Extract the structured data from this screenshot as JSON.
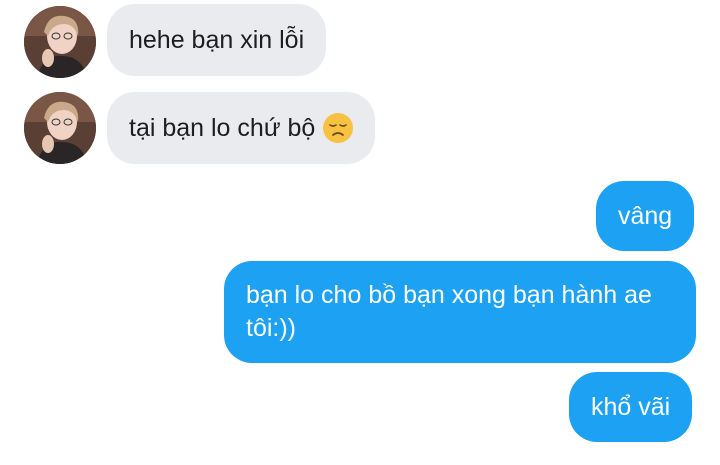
{
  "messages": [
    {
      "side": "incoming",
      "text": "hehe bạn xin lỗi"
    },
    {
      "side": "incoming",
      "text": "tại bạn lo chứ bộ",
      "emoji": "disappointed-face-icon"
    },
    {
      "side": "outgoing",
      "text": "vâng"
    },
    {
      "side": "outgoing",
      "text": "bạn lo cho bồ bạn xong bạn hành ae tôi:))"
    },
    {
      "side": "outgoing",
      "text": "khổ vãi"
    }
  ],
  "colors": {
    "incoming_bubble": "#e9ebee",
    "outgoing_bubble": "#1da1f2",
    "incoming_text": "#1c1e21",
    "outgoing_text": "#ffffff"
  }
}
